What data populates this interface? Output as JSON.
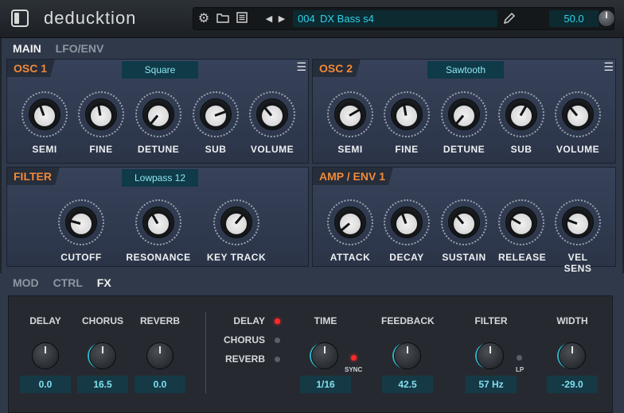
{
  "app": {
    "title": "deducktion"
  },
  "toolbar": {
    "preset_number": "004",
    "preset_name": "DX Bass s4",
    "zoom": "50.0"
  },
  "main_tabs": [
    "MAIN",
    "LFO/ENV"
  ],
  "osc1": {
    "title": "OSC 1",
    "waveform": "Square",
    "knobs": [
      "SEMI",
      "FINE",
      "DETUNE",
      "SUB",
      "VOLUME"
    ]
  },
  "osc2": {
    "title": "OSC 2",
    "waveform": "Sawtooth",
    "knobs": [
      "SEMI",
      "FINE",
      "DETUNE",
      "SUB",
      "VOLUME"
    ]
  },
  "filter": {
    "title": "FILTER",
    "type": "Lowpass 12",
    "knobs": [
      "CUTOFF",
      "RESONANCE",
      "KEY TRACK"
    ]
  },
  "amp": {
    "title": "AMP / ENV 1",
    "knobs": [
      "ATTACK",
      "DECAY",
      "SUSTAIN",
      "RELEASE",
      "VEL SENS"
    ]
  },
  "bottom_tabs": [
    "MOD",
    "CTRL",
    "FX"
  ],
  "fx": {
    "sends": [
      {
        "label": "DELAY",
        "value": "0.0"
      },
      {
        "label": "CHORUS",
        "value": "16.5"
      },
      {
        "label": "REVERB",
        "value": "0.0"
      }
    ],
    "selectors": [
      "DELAY",
      "CHORUS",
      "REVERB"
    ],
    "params": [
      {
        "label": "TIME",
        "value": "1/16",
        "tag": "SYNC"
      },
      {
        "label": "FEEDBACK",
        "value": "42.5"
      },
      {
        "label": "FILTER",
        "value": "57 Hz",
        "tag": "LP"
      },
      {
        "label": "WIDTH",
        "value": "-29.0"
      }
    ]
  },
  "colors": {
    "accent": "#2fd2e8",
    "section_title": "#f08a3a",
    "led_on": "#ff2929"
  }
}
